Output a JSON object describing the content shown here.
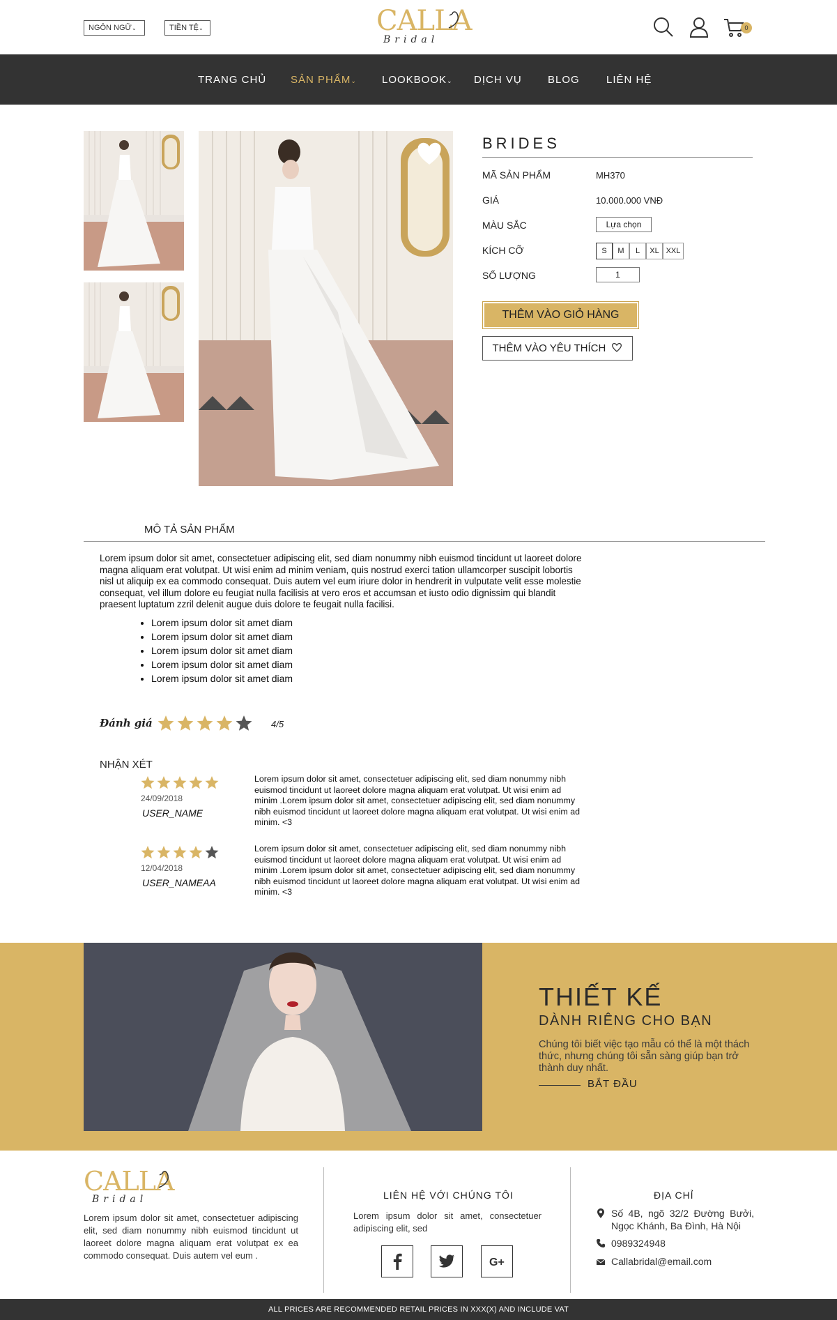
{
  "header": {
    "language_label": "NGÔN NGỮ",
    "currency_label": "TIỀN TỆ",
    "logo_main": "CALLA",
    "logo_sub": "Bridal",
    "cart_count": "0"
  },
  "nav": {
    "items": [
      {
        "label": "TRANG CHỦ"
      },
      {
        "label": "SẢN PHẨM"
      },
      {
        "label": "LOOKBOOK"
      },
      {
        "label": "DỊCH VỤ"
      },
      {
        "label": "BLOG"
      },
      {
        "label": "LIÊN HỆ"
      }
    ],
    "active": "SẢN PHẨM"
  },
  "product": {
    "category": "BRIDES",
    "code_label": "MÃ SẢN PHẨM",
    "code": "MH370",
    "price_label": "GIÁ",
    "price": "10.000.000 VNĐ",
    "color_label": "MÀU SẮC",
    "color_button": "Lựa chọn",
    "size_label": "KÍCH CỠ",
    "sizes": [
      "S",
      "M",
      "L",
      "XL",
      "XXL"
    ],
    "selected_size": "S",
    "qty_label": "SỐ LƯỢNG",
    "qty": "1",
    "add_to_cart": "THÊM VÀO GIỎ HÀNG",
    "add_to_wishlist": "THÊM VÀO YÊU THÍCH"
  },
  "description": {
    "tab_label": "MÔ TẢ SẢN PHẨM",
    "text": "Lorem ipsum dolor sit amet, consectetuer adipiscing elit, sed diam nonummy nibh euismod tincidunt ut laoreet dolore magna aliquam erat volutpat. Ut wisi enim ad minim veniam, quis nostrud exerci tation ullamcorper suscipit lobortis nisl ut aliquip ex ea commodo consequat. Duis autem vel eum iriure dolor in hendrerit in vulputate velit esse molestie consequat, vel illum dolore eu feugiat nulla facilisis at vero eros et accumsan et iusto odio dignissim qui blandit praesent luptatum zzril delenit augue duis dolore te feugait nulla facilisi.",
    "bullets": [
      "Lorem ipsum dolor sit amet diam",
      "Lorem ipsum dolor sit amet diam",
      "Lorem ipsum dolor sit amet diam",
      "Lorem ipsum dolor sit amet diam",
      "Lorem ipsum dolor sit amet diam"
    ]
  },
  "rating": {
    "label": "Đánh giá",
    "stars": 4,
    "max": 5,
    "value_text": "4/5"
  },
  "reviews": {
    "title": "NHẬN XÉT",
    "items": [
      {
        "stars": 5,
        "date": "24/09/2018",
        "user": "USER_NAME",
        "text": "Lorem ipsum dolor sit amet, consectetuer adipiscing elit, sed diam nonummy nibh euismod tincidunt ut laoreet dolore magna aliquam erat volutpat. Ut wisi enim ad minim .Lorem ipsum dolor sit amet, consectetuer adipiscing elit, sed diam nonummy nibh euismod tincidunt ut laoreet dolore magna aliquam erat volutpat. Ut wisi enim ad minim. <3"
      },
      {
        "stars": 4,
        "date": "12/04/2018",
        "user": "USER_NAMEAA",
        "text": "Lorem ipsum dolor sit amet, consectetuer adipiscing elit, sed diam nonummy nibh euismod tincidunt ut laoreet dolore magna aliquam erat volutpat. Ut wisi enim ad minim .Lorem ipsum dolor sit amet, consectetuer adipiscing elit, sed diam nonummy nibh euismod tincidunt ut laoreet dolore magna aliquam erat volutpat. Ut wisi enim ad minim. <3"
      }
    ]
  },
  "banner": {
    "title": "THIẾT KẾ",
    "subtitle": "DÀNH RIÊNG CHO BẠN",
    "text": "Chúng tôi biết việc tạo mẫu có thể là một thách thức, nhưng chúng tôi sẵn sàng giúp bạn trở thành duy nhất.",
    "cta": "BẮT ĐẦU"
  },
  "footer": {
    "logo_main": "CALLA",
    "logo_sub": "Bridal",
    "about": "Lorem ipsum dolor sit amet, consectetuer adipiscing elit, sed diam nonummy nibh euismod tincidunt ut laoreet dolore magna aliquam erat volutpat ex ea commodo consequat. Duis autem vel eum .",
    "contact_title": "LIÊN HỆ VỚI CHÚNG TÔI",
    "contact_text": "Lorem ipsum dolor sit amet, consectetuer adipiscing elit, sed",
    "social": [
      "facebook-icon",
      "twitter-icon",
      "google-plus-icon"
    ],
    "address_title": "ĐỊA CHỈ",
    "address": "Số 4B, ngõ 32/2 Đường Bưởi, Ngọc Khánh, Ba Đình, Hà Nội",
    "phone": "0989324948",
    "email": "Callabridal@email.com",
    "bottom_note": "ALL PRICES ARE RECOMMENDED RETAIL PRICES IN XXX(X) AND INCLUDE VAT"
  },
  "colors": {
    "accent": "#d9b565",
    "dark": "#333333"
  }
}
